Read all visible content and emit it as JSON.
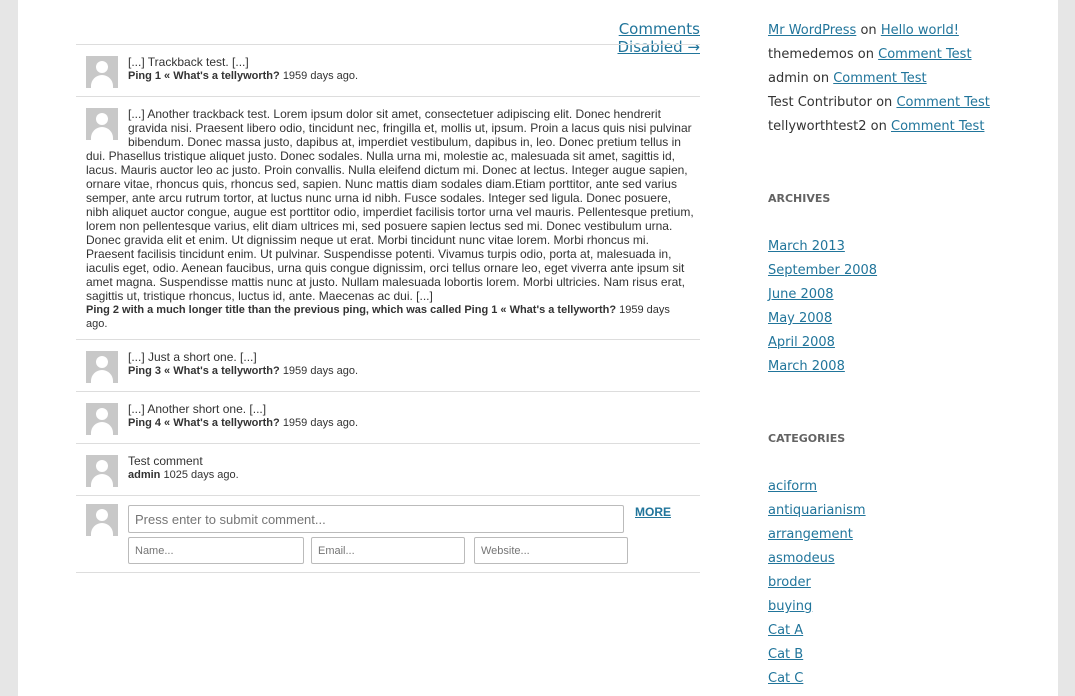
{
  "comments_disabled": "Comments Disabled →",
  "comments": [
    {
      "text": "[...] Trackback test. [...]",
      "author": "Ping 1 « What's a tellyworth?",
      "date": "1959 days ago."
    },
    {
      "text": "[...] Another trackback test.  Lorem ipsum dolor sit amet, consectetuer adipiscing elit. Donec hendrerit gravida nisi. Praesent libero odio, tincidunt nec, fringilla et, mollis ut, ipsum. Proin a lacus quis nisi pulvinar bibendum. Donec massa justo, dapibus at, imperdiet vestibulum, dapibus in, leo. Donec pretium tellus in dui. Phasellus tristique aliquet justo. Donec sodales. Nulla urna mi, molestie ac, malesuada sit amet, sagittis id, lacus. Mauris auctor leo ac justo. Proin convallis. Nulla eleifend dictum mi. Donec at lectus. Integer augue sapien, ornare vitae, rhoncus quis, rhoncus sed, sapien. Nunc mattis diam sodales diam.Etiam porttitor, ante sed varius semper, ante arcu rutrum tortor, at luctus nunc urna id nibh. Fusce sodales. Integer sed ligula. Donec posuere, nibh aliquet auctor congue, augue est porttitor odio, imperdiet facilisis tortor urna vel mauris. Pellentesque pretium, lorem non pellentesque varius, elit diam ultrices mi, sed posuere sapien lectus sed mi. Donec vestibulum urna. Donec gravida elit et enim. Ut dignissim neque ut erat. Morbi tincidunt nunc vitae lorem. Morbi rhoncus mi. Praesent facilisis tincidunt enim. Ut pulvinar. Suspendisse potenti. Vivamus turpis odio, porta at, malesuada in, iaculis eget, odio. Aenean faucibus, urna quis congue dignissim, orci tellus ornare leo, eget viverra ante ipsum sit amet magna. Suspendisse mattis nunc at justo. Nullam malesuada lobortis lorem. Morbi ultricies. Nam risus erat, sagittis ut, tristique rhoncus, luctus id, ante. Maecenas ac dui. [...]",
      "author": "Ping 2 with a much longer title than the previous ping, which was called Ping 1 « What's a tellyworth?",
      "date": "1959 days ago."
    },
    {
      "text": "[...] Just a short one. [...]",
      "author": "Ping 3 « What's a tellyworth?",
      "date": "1959 days ago."
    },
    {
      "text": "[...] Another short one. [...]",
      "author": "Ping 4 « What's a tellyworth?",
      "date": "1959 days ago."
    },
    {
      "text": "Test comment",
      "author": "admin",
      "date": "1025 days ago."
    }
  ],
  "form": {
    "comment_placeholder": "Press enter to submit comment...",
    "more_label": "MORE",
    "name_placeholder": "Name...",
    "email_placeholder": "Email...",
    "website_placeholder": "Website..."
  },
  "sidebar": {
    "recent_comments": [
      {
        "author": "Mr WordPress",
        "author_link": true,
        "on": "on",
        "post": "Hello world!"
      },
      {
        "author": "themedemos",
        "author_link": false,
        "on": "on",
        "post": "Comment Test"
      },
      {
        "author": "admin",
        "author_link": false,
        "on": "on",
        "post": "Comment Test"
      },
      {
        "author": "Test Contributor",
        "author_link": false,
        "on": "on",
        "post": "Comment Test"
      },
      {
        "author": "tellyworthtest2",
        "author_link": false,
        "on": "on",
        "post": "Comment Test"
      }
    ],
    "archives_title": "ARCHIVES",
    "archives": [
      "March 2013",
      "September 2008",
      "June 2008",
      "May 2008",
      "April 2008",
      "March 2008"
    ],
    "categories_title": "CATEGORIES",
    "categories": [
      "aciform",
      "antiquarianism",
      "arrangement",
      "asmodeus",
      "broder",
      "buying",
      "Cat A",
      "Cat B",
      "Cat C"
    ]
  }
}
